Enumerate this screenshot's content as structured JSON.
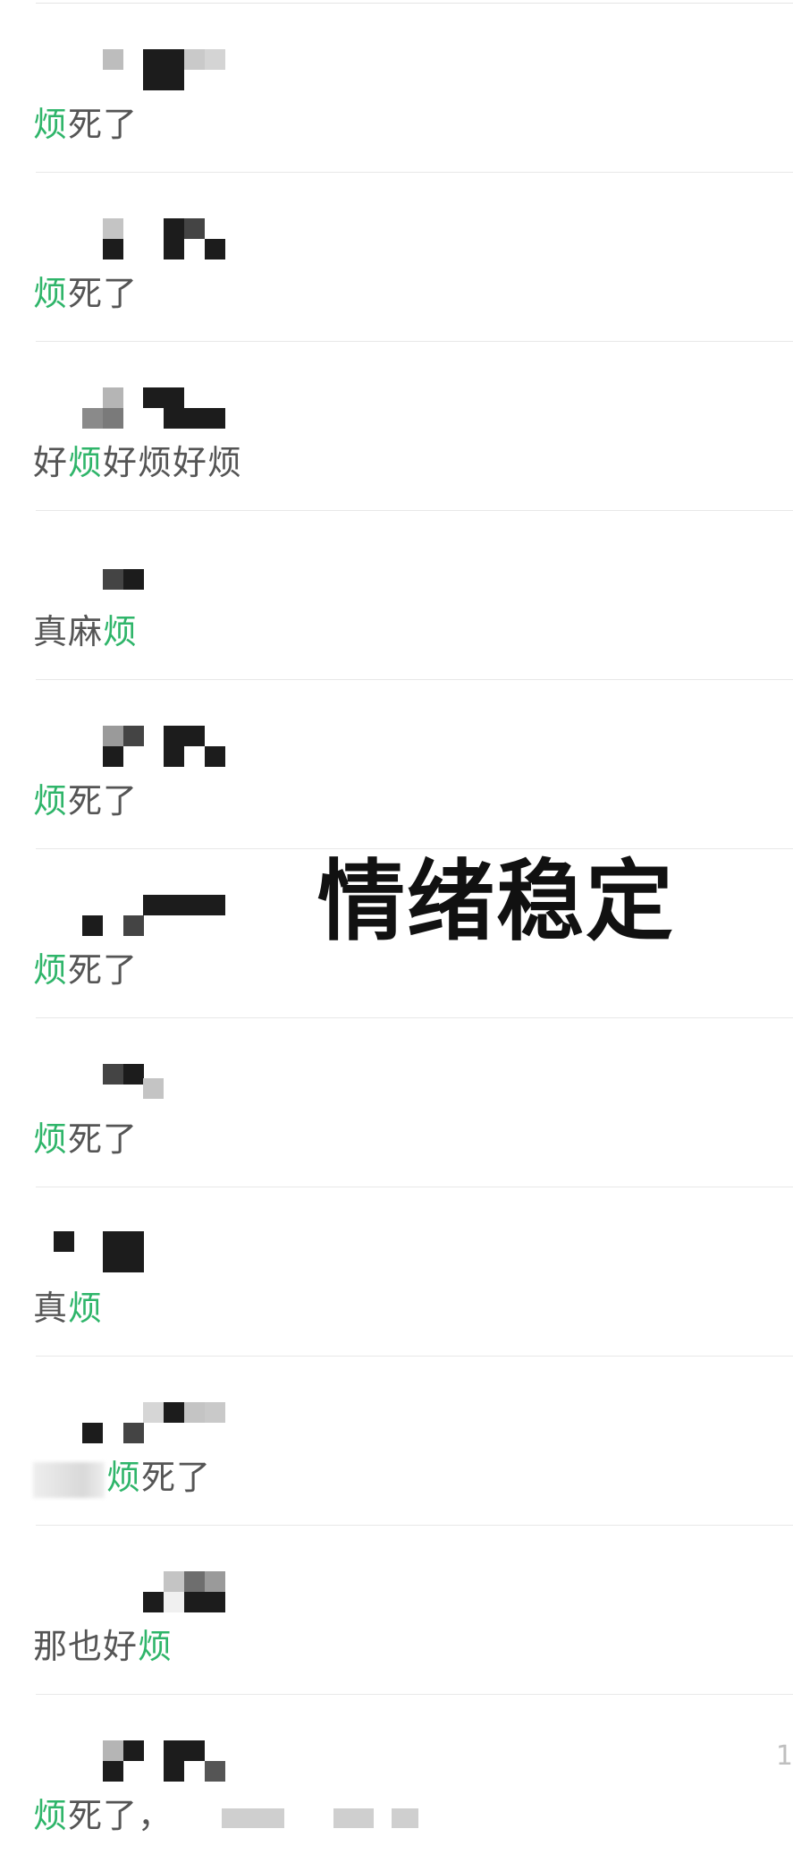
{
  "comments": [
    {
      "before": "",
      "keyword": "烦",
      "after": "死了"
    },
    {
      "before": "",
      "keyword": "烦",
      "after": "死了"
    },
    {
      "before": "好",
      "keyword": "烦",
      "after": "好烦好烦"
    },
    {
      "before": "真麻",
      "keyword": "烦",
      "after": ""
    },
    {
      "before": "",
      "keyword": "烦",
      "after": "死了"
    },
    {
      "before": "",
      "keyword": "烦",
      "after": "死了"
    },
    {
      "before": "",
      "keyword": "烦",
      "after": "死了"
    },
    {
      "before": "真",
      "keyword": "烦",
      "after": ""
    },
    {
      "before": "",
      "keyword": "烦",
      "after": "死了"
    },
    {
      "before": "那也好",
      "keyword": "烦",
      "after": ""
    },
    {
      "before": "",
      "keyword": "烦",
      "after": "死了，"
    }
  ],
  "last_comment_count": "1",
  "overlay_text": "情绪稳定",
  "colors": {
    "keyword_highlight": "#2fb56a",
    "message_text": "#555555",
    "divider": "#e8e8e8",
    "overlay_text": "#111111"
  }
}
